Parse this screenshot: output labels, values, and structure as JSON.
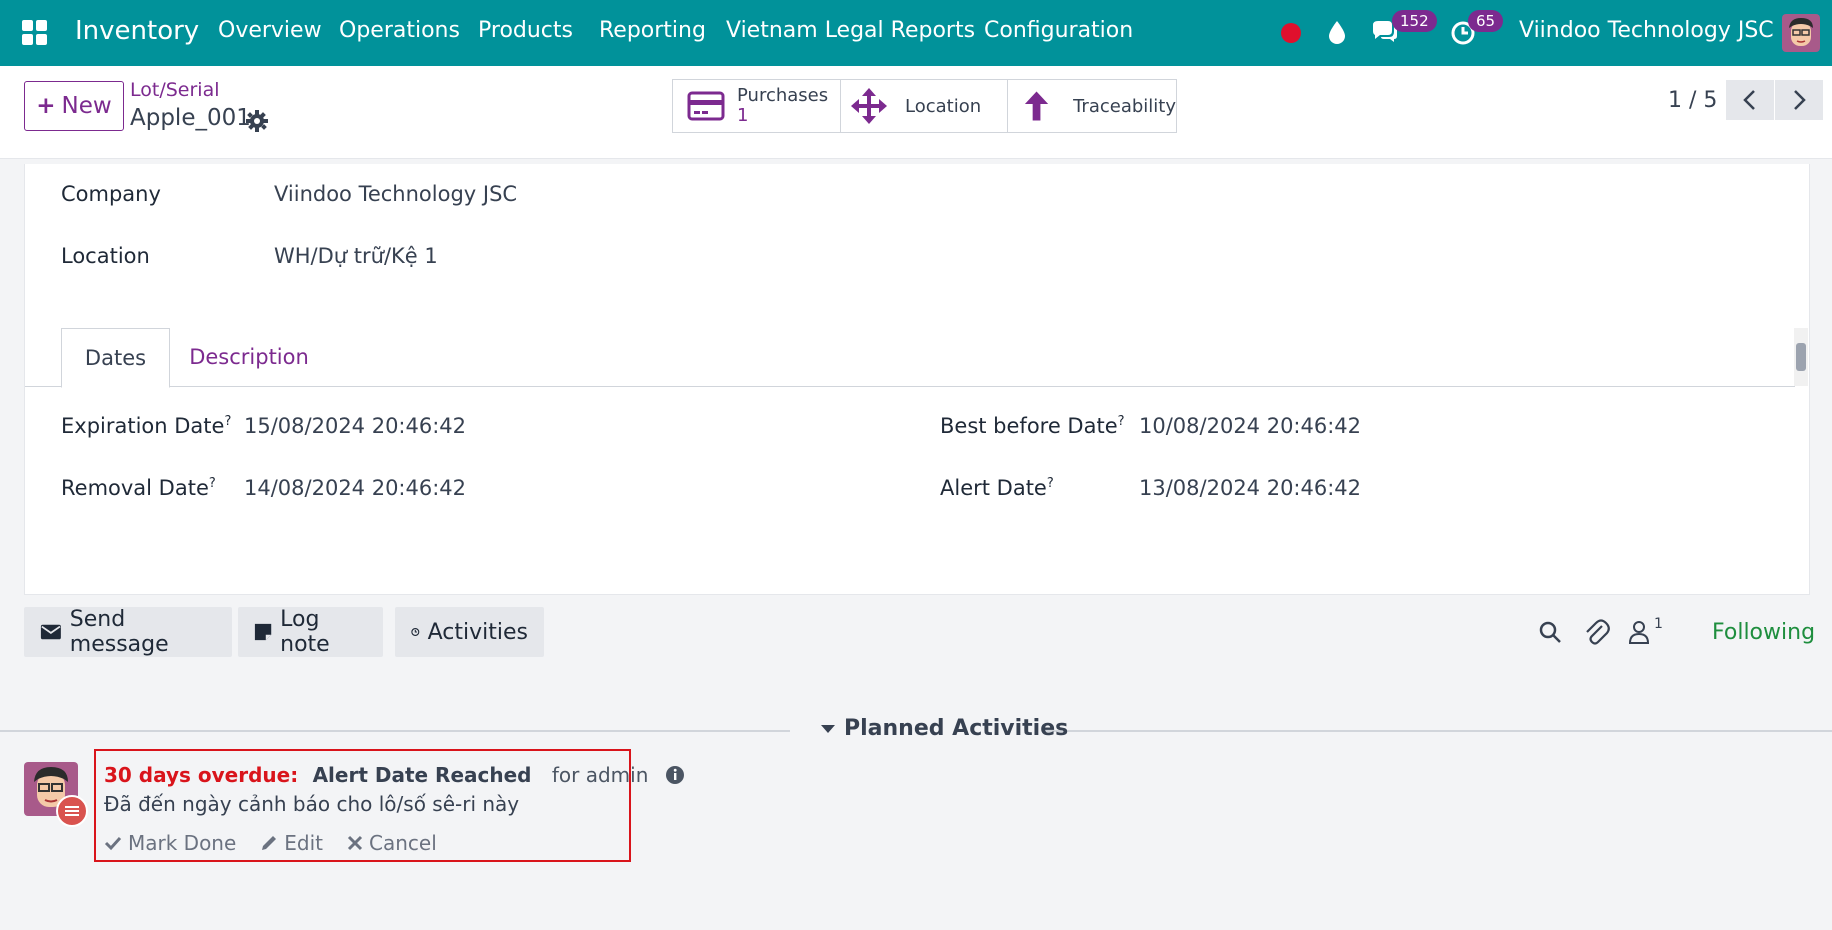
{
  "navbar": {
    "brand": "Inventory",
    "menu": [
      "Overview",
      "Operations",
      "Products",
      "Reporting",
      "Vietnam Legal Reports",
      "Configuration"
    ],
    "chat_badge": "152",
    "activity_badge": "65",
    "company": "Viindoo Technology JSC"
  },
  "control_panel": {
    "new_label": "New",
    "breadcrumb_parent": "Lot/Serial",
    "breadcrumb_current": "Apple_001",
    "smart_buttons": {
      "purchases_label": "Purchases",
      "purchases_count": "1",
      "location_label": "Location",
      "traceability_label": "Traceability"
    },
    "pager": "1 / 5"
  },
  "form": {
    "company_label": "Company",
    "company_value": "Viindoo Technology JSC",
    "location_label": "Location",
    "location_value": "WH/Dự trữ/Kệ 1",
    "tabs": [
      "Dates",
      "Description"
    ],
    "expiration_label": "Expiration Date",
    "expiration_value": "15/08/2024 20:46:42",
    "removal_label": "Removal Date",
    "removal_value": "14/08/2024 20:46:42",
    "best_before_label": "Best before Date",
    "best_before_value": "10/08/2024 20:46:42",
    "alert_label": "Alert Date",
    "alert_value": "13/08/2024 20:46:42",
    "help_mark": "?"
  },
  "chatter": {
    "send_message": "Send message",
    "log_note": "Log note",
    "activities": "Activities",
    "followers_count": "1",
    "following": "Following",
    "planned_title": "Planned Activities",
    "activity": {
      "overdue": "30 days overdue:",
      "summary": "Alert Date Reached",
      "assigned": "for admin",
      "note": "Đã đến ngày cảnh báo cho lô/số sê-ri này",
      "mark_done": "Mark Done",
      "edit": "Edit",
      "cancel": "Cancel"
    }
  },
  "colors": {
    "navbar": "#01929a",
    "accent": "#7c2a8f",
    "overdue": "#d9141b",
    "following": "#1e8e3e"
  }
}
